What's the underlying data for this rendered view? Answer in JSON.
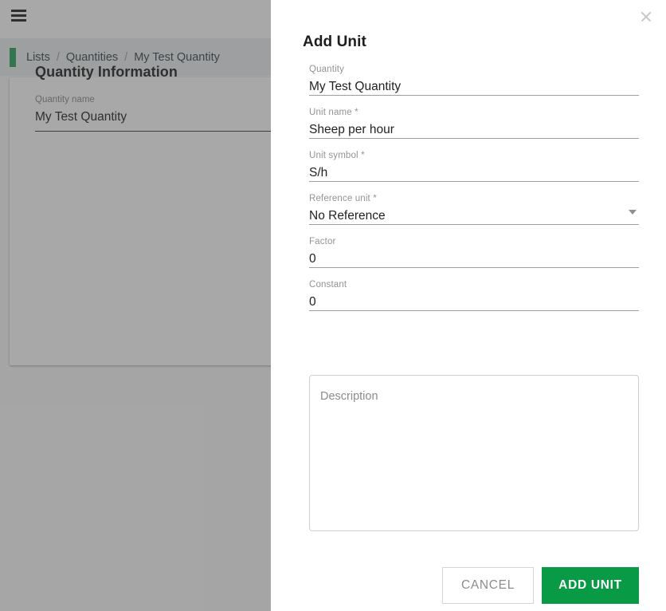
{
  "background": {
    "menu_icon": "hamburger-menu-icon",
    "breadcrumb": {
      "items": [
        "Lists",
        "Quantities",
        "My Test Quantity"
      ],
      "separator": "/",
      "accent_color": "#2e9e5b"
    },
    "card": {
      "title": "Quantity Information",
      "quantity_name": {
        "label": "Quantity name",
        "value": "My Test Quantity"
      }
    }
  },
  "dialog": {
    "title": "Add Unit",
    "close_icon": "close-icon",
    "fields": [
      {
        "label": "Quantity",
        "value": "My Test Quantity"
      },
      {
        "label": "Unit name *",
        "value": "Sheep per hour"
      },
      {
        "label": "Unit symbol *",
        "value": "S/h"
      },
      {
        "label": "Reference unit *",
        "value": "No Reference"
      },
      {
        "label": "Factor",
        "value": "0"
      },
      {
        "label": "Constant",
        "value": "0"
      }
    ],
    "description": {
      "placeholder": "Description",
      "value": ""
    },
    "buttons": {
      "cancel": "CANCEL",
      "submit": "ADD UNIT",
      "submit_color": "#089a45"
    }
  }
}
